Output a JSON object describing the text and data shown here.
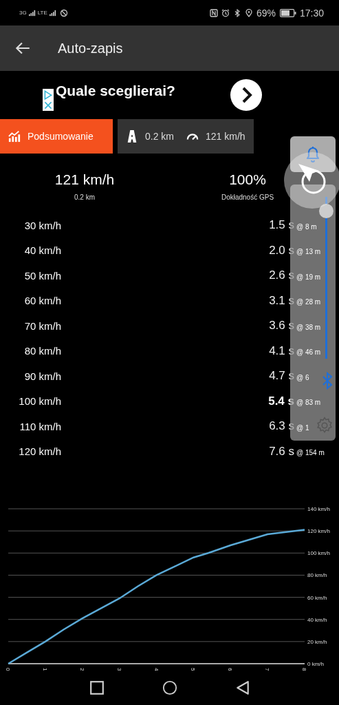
{
  "status_bar": {
    "network_1": "3G",
    "network_2": "LTE",
    "battery": "69%",
    "time": "17:30"
  },
  "toolbar": {
    "title": "Auto-zapis"
  },
  "ad": {
    "text": "Quale sceglierai?"
  },
  "tabs": [
    {
      "kind": "summary",
      "label": "Podsumowanie",
      "selected": true
    },
    {
      "kind": "stats",
      "distance": "0.2 km",
      "speed": "121 km/h",
      "selected": false
    }
  ],
  "summary": [
    {
      "value": "121 km/h",
      "label": "0.2 km"
    },
    {
      "value": "100%",
      "label": "Dokładność GPS"
    }
  ],
  "rows": [
    {
      "speed": "30 km/h",
      "time": "1.5 s",
      "distance": "@ 8 m",
      "highlighted": false
    },
    {
      "speed": "40 km/h",
      "time": "2.0 s",
      "distance": "@ 13 m",
      "highlighted": false
    },
    {
      "speed": "50 km/h",
      "time": "2.6 s",
      "distance": "@ 19 m",
      "highlighted": false
    },
    {
      "speed": "60 km/h",
      "time": "3.1 s",
      "distance": "@ 28 m",
      "highlighted": false
    },
    {
      "speed": "70 km/h",
      "time": "3.6 s",
      "distance": "@ 38 m",
      "highlighted": false
    },
    {
      "speed": "80 km/h",
      "time": "4.1 s",
      "distance": "@ 46 m",
      "highlighted": false
    },
    {
      "speed": "90 km/h",
      "time": "4.7 s",
      "distance": "@ 6",
      "highlighted": false
    },
    {
      "speed": "100 km/h",
      "time": "5.4 s",
      "distance": "@ 83 m",
      "highlighted": true
    },
    {
      "speed": "110 km/h",
      "time": "6.3 s",
      "distance": "@ 1",
      "highlighted": false
    },
    {
      "speed": "120 km/h",
      "time": "7.6 s",
      "distance": "@ 154 m",
      "highlighted": false
    }
  ],
  "side_panel": {
    "slider": {
      "level": 1
    }
  },
  "chart": {
    "chart_data": {
      "type": "line",
      "x": [
        0,
        0.5,
        1,
        1.5,
        2,
        2.5,
        3,
        3.5,
        4,
        4.5,
        5,
        5.4,
        6,
        6.5,
        7,
        7.5,
        8
      ],
      "grid": true,
      "series": [
        {
          "color": "#5aa9d6",
          "values": [
            0,
            10,
            20,
            31,
            41,
            50,
            59,
            70,
            80,
            88,
            96,
            100,
            107,
            112,
            117,
            119,
            121
          ]
        }
      ],
      "xlim": [
        0,
        8
      ],
      "ylim": [
        0,
        140
      ],
      "xticks": [
        0,
        1,
        2,
        3,
        4,
        5,
        6,
        7,
        8
      ],
      "yticks": [
        {
          "value": 0,
          "label": "0 km/h"
        },
        {
          "value": 20,
          "label": "20 km/h"
        },
        {
          "value": 40,
          "label": "40 km/h"
        },
        {
          "value": 60,
          "label": "60 km/h"
        },
        {
          "value": 80,
          "label": "80 km/h"
        },
        {
          "value": 100,
          "label": "100 km/h"
        },
        {
          "value": 120,
          "label": "120 km/h"
        },
        {
          "value": 140,
          "label": "140 km/h"
        }
      ]
    }
  }
}
